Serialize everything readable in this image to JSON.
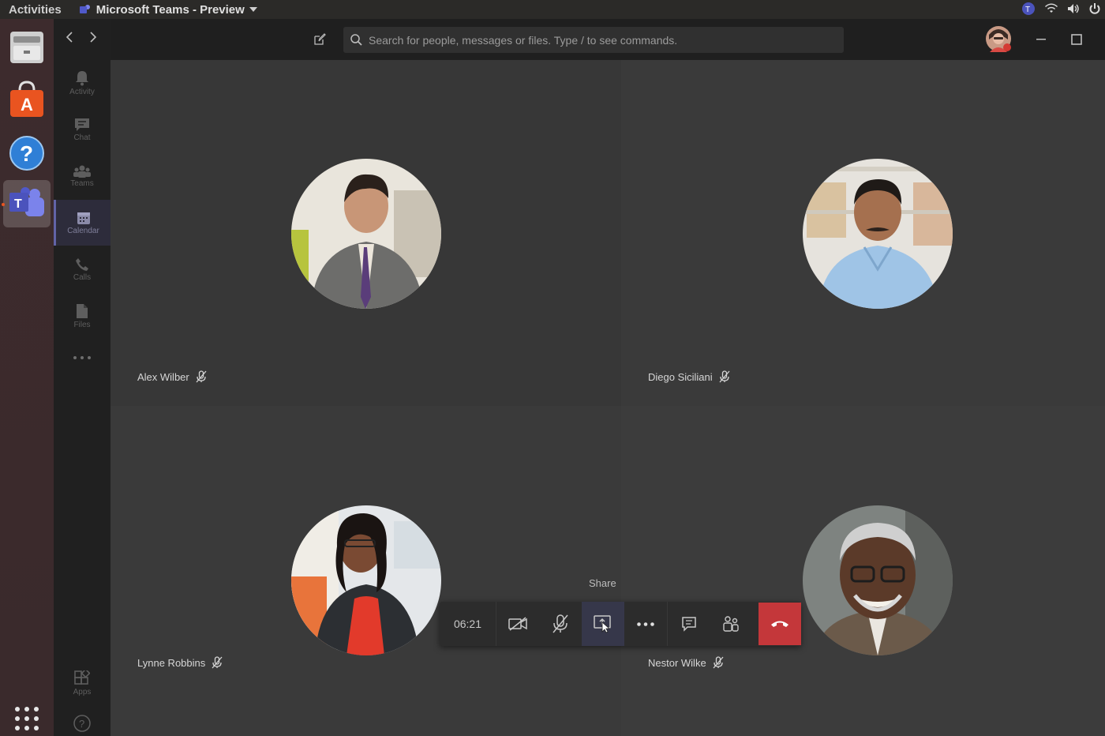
{
  "topbar": {
    "activities": "Activities",
    "app_name": "Microsoft Teams - Preview"
  },
  "search": {
    "placeholder": "Search for people, messages or files. Type / to see commands."
  },
  "rail": {
    "items": [
      {
        "label": "Activity",
        "icon": "bell-icon"
      },
      {
        "label": "Chat",
        "icon": "chat-icon"
      },
      {
        "label": "Teams",
        "icon": "teams-icon"
      },
      {
        "label": "Calendar",
        "icon": "calendar-icon"
      },
      {
        "label": "Calls",
        "icon": "phone-icon"
      },
      {
        "label": "Files",
        "icon": "file-icon"
      }
    ],
    "apps": "Apps"
  },
  "participants": [
    {
      "name": "Alex Wilber"
    },
    {
      "name": "Diego Siciliani"
    },
    {
      "name": "Lynne Robbins"
    },
    {
      "name": "Nestor Wilke"
    }
  ],
  "call": {
    "timer": "06:21",
    "share_tooltip": "Share"
  },
  "colors": {
    "accent": "#6264a7",
    "hangup": "#c4373a",
    "tile_bg": "#3a3a3a"
  }
}
